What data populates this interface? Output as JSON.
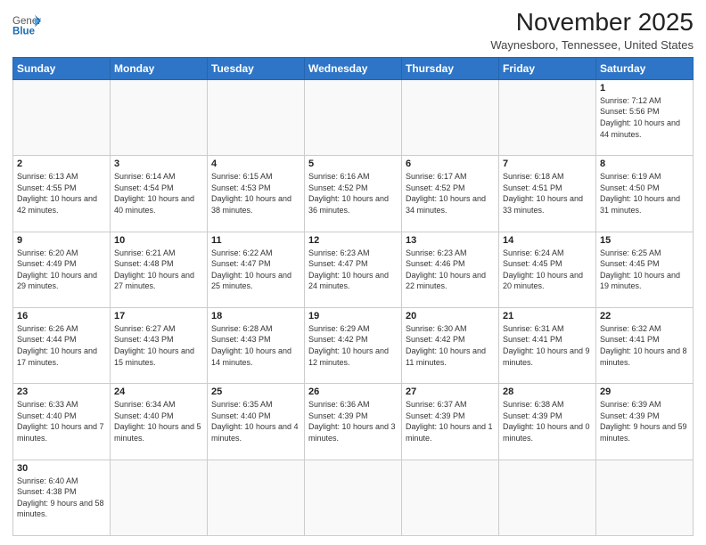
{
  "logo": {
    "text_general": "General",
    "text_blue": "Blue"
  },
  "title": "November 2025",
  "subtitle": "Waynesboro, Tennessee, United States",
  "days_of_week": [
    "Sunday",
    "Monday",
    "Tuesday",
    "Wednesday",
    "Thursday",
    "Friday",
    "Saturday"
  ],
  "weeks": [
    [
      {
        "num": "",
        "info": ""
      },
      {
        "num": "",
        "info": ""
      },
      {
        "num": "",
        "info": ""
      },
      {
        "num": "",
        "info": ""
      },
      {
        "num": "",
        "info": ""
      },
      {
        "num": "",
        "info": ""
      },
      {
        "num": "1",
        "info": "Sunrise: 7:12 AM\nSunset: 5:56 PM\nDaylight: 10 hours and 44 minutes."
      }
    ],
    [
      {
        "num": "2",
        "info": "Sunrise: 6:13 AM\nSunset: 4:55 PM\nDaylight: 10 hours and 42 minutes."
      },
      {
        "num": "3",
        "info": "Sunrise: 6:14 AM\nSunset: 4:54 PM\nDaylight: 10 hours and 40 minutes."
      },
      {
        "num": "4",
        "info": "Sunrise: 6:15 AM\nSunset: 4:53 PM\nDaylight: 10 hours and 38 minutes."
      },
      {
        "num": "5",
        "info": "Sunrise: 6:16 AM\nSunset: 4:52 PM\nDaylight: 10 hours and 36 minutes."
      },
      {
        "num": "6",
        "info": "Sunrise: 6:17 AM\nSunset: 4:52 PM\nDaylight: 10 hours and 34 minutes."
      },
      {
        "num": "7",
        "info": "Sunrise: 6:18 AM\nSunset: 4:51 PM\nDaylight: 10 hours and 33 minutes."
      },
      {
        "num": "8",
        "info": "Sunrise: 6:19 AM\nSunset: 4:50 PM\nDaylight: 10 hours and 31 minutes."
      }
    ],
    [
      {
        "num": "9",
        "info": "Sunrise: 6:20 AM\nSunset: 4:49 PM\nDaylight: 10 hours and 29 minutes."
      },
      {
        "num": "10",
        "info": "Sunrise: 6:21 AM\nSunset: 4:48 PM\nDaylight: 10 hours and 27 minutes."
      },
      {
        "num": "11",
        "info": "Sunrise: 6:22 AM\nSunset: 4:47 PM\nDaylight: 10 hours and 25 minutes."
      },
      {
        "num": "12",
        "info": "Sunrise: 6:23 AM\nSunset: 4:47 PM\nDaylight: 10 hours and 24 minutes."
      },
      {
        "num": "13",
        "info": "Sunrise: 6:23 AM\nSunset: 4:46 PM\nDaylight: 10 hours and 22 minutes."
      },
      {
        "num": "14",
        "info": "Sunrise: 6:24 AM\nSunset: 4:45 PM\nDaylight: 10 hours and 20 minutes."
      },
      {
        "num": "15",
        "info": "Sunrise: 6:25 AM\nSunset: 4:45 PM\nDaylight: 10 hours and 19 minutes."
      }
    ],
    [
      {
        "num": "16",
        "info": "Sunrise: 6:26 AM\nSunset: 4:44 PM\nDaylight: 10 hours and 17 minutes."
      },
      {
        "num": "17",
        "info": "Sunrise: 6:27 AM\nSunset: 4:43 PM\nDaylight: 10 hours and 15 minutes."
      },
      {
        "num": "18",
        "info": "Sunrise: 6:28 AM\nSunset: 4:43 PM\nDaylight: 10 hours and 14 minutes."
      },
      {
        "num": "19",
        "info": "Sunrise: 6:29 AM\nSunset: 4:42 PM\nDaylight: 10 hours and 12 minutes."
      },
      {
        "num": "20",
        "info": "Sunrise: 6:30 AM\nSunset: 4:42 PM\nDaylight: 10 hours and 11 minutes."
      },
      {
        "num": "21",
        "info": "Sunrise: 6:31 AM\nSunset: 4:41 PM\nDaylight: 10 hours and 9 minutes."
      },
      {
        "num": "22",
        "info": "Sunrise: 6:32 AM\nSunset: 4:41 PM\nDaylight: 10 hours and 8 minutes."
      }
    ],
    [
      {
        "num": "23",
        "info": "Sunrise: 6:33 AM\nSunset: 4:40 PM\nDaylight: 10 hours and 7 minutes."
      },
      {
        "num": "24",
        "info": "Sunrise: 6:34 AM\nSunset: 4:40 PM\nDaylight: 10 hours and 5 minutes."
      },
      {
        "num": "25",
        "info": "Sunrise: 6:35 AM\nSunset: 4:40 PM\nDaylight: 10 hours and 4 minutes."
      },
      {
        "num": "26",
        "info": "Sunrise: 6:36 AM\nSunset: 4:39 PM\nDaylight: 10 hours and 3 minutes."
      },
      {
        "num": "27",
        "info": "Sunrise: 6:37 AM\nSunset: 4:39 PM\nDaylight: 10 hours and 1 minute."
      },
      {
        "num": "28",
        "info": "Sunrise: 6:38 AM\nSunset: 4:39 PM\nDaylight: 10 hours and 0 minutes."
      },
      {
        "num": "29",
        "info": "Sunrise: 6:39 AM\nSunset: 4:39 PM\nDaylight: 9 hours and 59 minutes."
      }
    ],
    [
      {
        "num": "30",
        "info": "Sunrise: 6:40 AM\nSunset: 4:38 PM\nDaylight: 9 hours and 58 minutes."
      },
      {
        "num": "",
        "info": ""
      },
      {
        "num": "",
        "info": ""
      },
      {
        "num": "",
        "info": ""
      },
      {
        "num": "",
        "info": ""
      },
      {
        "num": "",
        "info": ""
      },
      {
        "num": "",
        "info": ""
      }
    ]
  ]
}
